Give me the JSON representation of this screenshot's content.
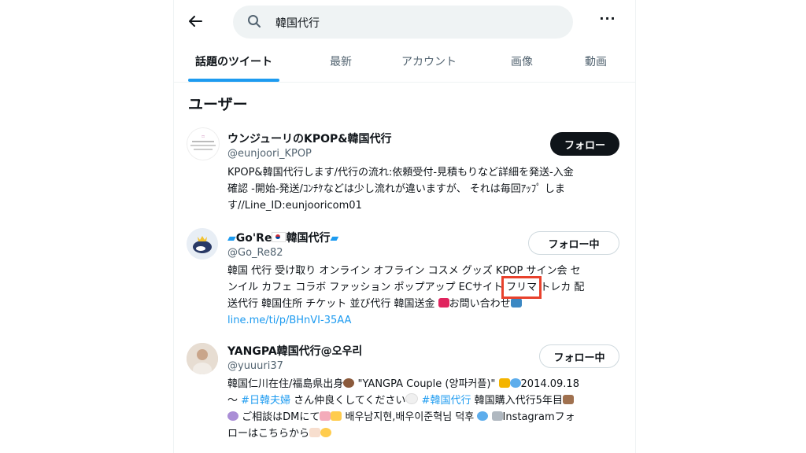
{
  "header": {
    "search_text": "韓国代行"
  },
  "tabs": [
    {
      "label": "話題のツイート"
    },
    {
      "label": "最新"
    },
    {
      "label": "アカウント"
    },
    {
      "label": "画像"
    },
    {
      "label": "動画"
    }
  ],
  "section_title": "ユーザー",
  "users": [
    {
      "name": "ウンジューリのKPOP&韓国代行",
      "handle": "@eunjoori_KPOP",
      "bio_lines": [
        "KPOP&韓国代行します/代行の流れ:依頼受付-見積もりなど詳細を発送-入金",
        "確認 -開始-発送/ｺﾝﾁｹなどは少し流れが違いますが、 それは毎回ｱｯﾌﾟ しま",
        "す//Line_ID:eunjooricom01"
      ],
      "button": "フォロー"
    },
    {
      "name": "Go'Re",
      "name_suffix": "韓国代行",
      "handle": "@Go_Re82",
      "bio_line1": "韓国 代行 受け取り オンライン オフライン コスメ グッズ KPOP サイン会 セ",
      "bio_line2_pre": "ンイル カフェ コラボ ファッション ポップアップ ECサイト ",
      "bio_highlight": "フリマ",
      "bio_line2_post": " トレカ 配",
      "bio_line3": "送代行 韓国住所 チケット 並び代行 韓国送金 ",
      "bio_line3_end": "お問い合わせ",
      "bio_link": "line.me/ti/p/BHnVI-35AA",
      "button": "フォロー中"
    },
    {
      "name": "YANGPA韓国代行@오우리",
      "handle": "@yuuuri37",
      "bio_l1": "韓国仁川在住/福島県出身",
      "bio_l1b": " \"YANGPA Couple (양파커플)\" ",
      "bio_l1c": "2014.09.18",
      "bio_l2a": "〜 ",
      "bio_l2_tag1": "#日韓夫婦",
      "bio_l2b": " さん仲良くしてください",
      "bio_l2_tag2": "#韓国代行",
      "bio_l2c": " 韓国購入代行5年目",
      "bio_l3a": " ご相談はDMにて",
      "bio_l3b": " 배우남지현,배우이준혁님 덕후 ",
      "bio_l3c": "Instagramフォ",
      "bio_l4": "ローはこちらから",
      "button": "フォロー中"
    }
  ],
  "colors": {
    "accent": "#1d9bf0",
    "highlight_box": "#e8412c",
    "text": "#0f1419",
    "muted": "#536471"
  }
}
